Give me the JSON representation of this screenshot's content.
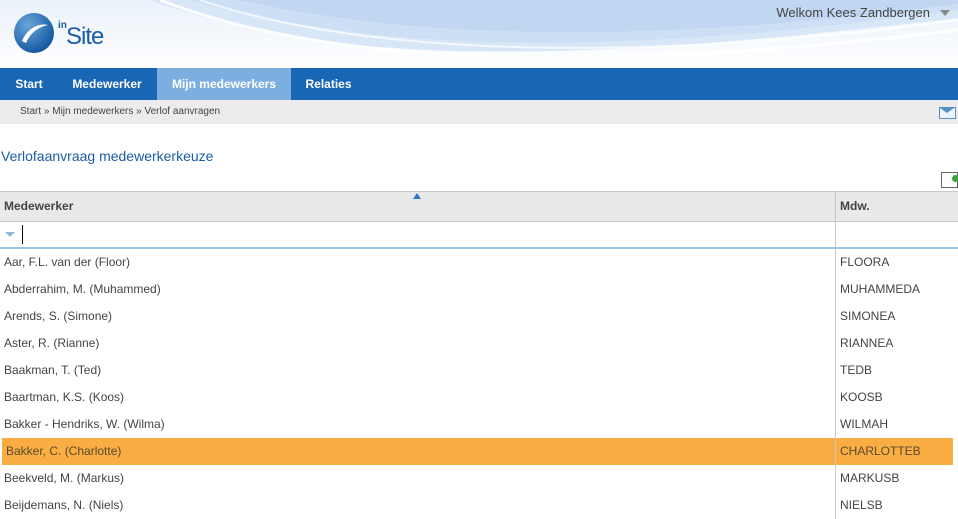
{
  "app": {
    "logo_in": "in",
    "logo_site": "Site"
  },
  "header": {
    "welcome": "Welkom Kees Zandbergen"
  },
  "nav": {
    "items": [
      {
        "label": "Start"
      },
      {
        "label": "Medewerker"
      },
      {
        "label": "Mijn medewerkers"
      },
      {
        "label": "Relaties"
      }
    ],
    "active": "Mijn medewerkers"
  },
  "breadcrumb": "Start » Mijn medewerkers » Verlof aanvragen",
  "page": {
    "title": "Verlofaanvraag medewerkerkeuze"
  },
  "grid": {
    "columns": [
      "Medewerker",
      "Mdw."
    ],
    "filter_value": "",
    "rows": [
      {
        "name": "Aar, F.L. van der (Floor)",
        "code": "FLOORA"
      },
      {
        "name": "Abderrahim, M. (Muhammed)",
        "code": "MUHAMMEDA"
      },
      {
        "name": "Arends, S. (Simone)",
        "code": "SIMONEA"
      },
      {
        "name": "Aster, R. (Rianne)",
        "code": "RIANNEA"
      },
      {
        "name": "Baakman, T. (Ted)",
        "code": "TEDB"
      },
      {
        "name": "Baartman, K.S. (Koos)",
        "code": "KOOSB"
      },
      {
        "name": "Bakker - Hendriks, W. (Wilma)",
        "code": "WILMAH"
      },
      {
        "name": "Bakker, C. (Charlotte)",
        "code": "CHARLOTTEB"
      },
      {
        "name": "Beekveld, M. (Markus)",
        "code": "MARKUSB"
      },
      {
        "name": "Beijdemans, N. (Niels)",
        "code": "NIELSB"
      }
    ],
    "selected_row": "Bakker, C. (Charlotte)"
  },
  "colors": {
    "nav": "#1866b4",
    "nav_active": "#7daee0",
    "selected_row": "#f9ad43",
    "title": "#1a5da6"
  }
}
